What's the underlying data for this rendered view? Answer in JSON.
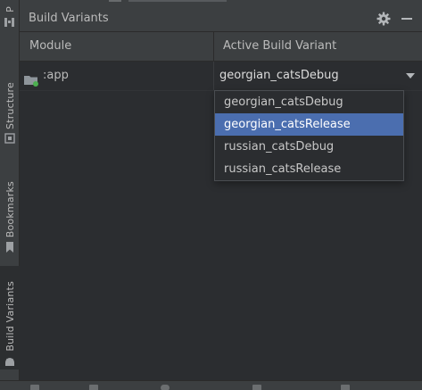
{
  "left_stripe": {
    "items": [
      {
        "label": "P"
      },
      {
        "label": "Structure"
      },
      {
        "label": "Bookmarks"
      },
      {
        "label": "Build Variants"
      }
    ]
  },
  "panel": {
    "title": "Build Variants",
    "settings_icon": "gear-icon",
    "minimize_icon": "minimize-icon"
  },
  "table": {
    "headers": [
      "Module",
      "Active Build Variant"
    ],
    "rows": [
      {
        "module": ":app",
        "variant": "georgian_catsDebug"
      }
    ]
  },
  "dropdown": {
    "options": [
      "georgian_catsDebug",
      "georgian_catsRelease",
      "russian_catsDebug",
      "russian_catsRelease"
    ],
    "highlighted": "georgian_catsRelease"
  },
  "colors": {
    "background": "#3c3f41",
    "table_background": "#2b2d30",
    "selection": "#4b6eaf",
    "text": "#bbbbbb",
    "module_status_dot": "#4caf50"
  }
}
